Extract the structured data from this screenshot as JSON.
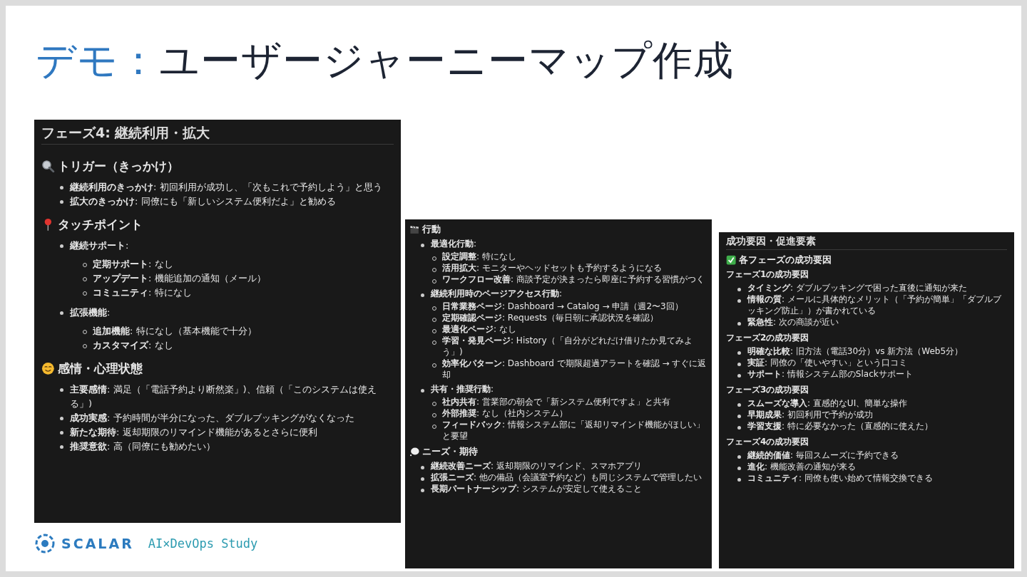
{
  "slide_title": {
    "accent": "デモ：",
    "main": "ユーザージャーニーマップ作成"
  },
  "panels": [
    {
      "blocks": [
        {
          "kind": "h2",
          "text": "フェーズ4: 継続利用・拡大"
        },
        {
          "kind": "h3",
          "text": "トリガー（きっかけ）"
        },
        {
          "kind": "list",
          "items": [
            {
              "text": "**継続利用のきっかけ**: 初回利用が成功し、「次もこれで予約しよう」と思う"
            },
            {
              "text": "**拡大のきっかけ**: 同僚にも「新しいシステム便利だよ」と勧める"
            }
          ]
        },
        {
          "kind": "h3",
          "text": "タッチポイント"
        },
        {
          "kind": "list",
          "items": [
            {
              "text": "**継続サポート**:",
              "children": [
                "**定期サポート**: なし",
                "**アップデート**: 機能追加の通知（メール）",
                "**コミュニティ**: 特になし"
              ]
            },
            {
              "text": "**拡張機能**:",
              "children": [
                "**追加機能**: 特になし（基本機能で十分）",
                "**カスタマイズ**: なし"
              ]
            }
          ]
        },
        {
          "kind": "h3",
          "text": "感情・心理状態"
        },
        {
          "kind": "list",
          "items": [
            {
              "text": "**主要感情**: 満足（「電話予約より断然楽」)、信頼（「このシステムは使える」)"
            },
            {
              "text": "**成功実感**: 予約時間が半分になった、ダブルブッキングがなくなった"
            },
            {
              "text": "**新たな期待**: 返却期限のリマインド機能があるとさらに便利"
            },
            {
              "text": "**推奨意欲**: 高（同僚にも勧めたい）"
            }
          ]
        }
      ]
    },
    {
      "blocks": [
        {
          "kind": "h3",
          "text": "行動"
        },
        {
          "kind": "list",
          "items": [
            {
              "text": "**最適化行動**:",
              "children": [
                "**設定調整**: 特になし",
                "**活用拡大**: モニターやヘッドセットも予約するようになる",
                "**ワークフロー改善**: 商談予定が決まったら即座に予約する習慣がつく"
              ]
            },
            {
              "text": "**継続利用時のページアクセス行動**:",
              "children": [
                "**日常業務ページ**: Dashboard → Catalog → 申請（週2〜3回）",
                "**定期確認ページ**: Requests（毎日朝に承認状況を確認）",
                "**最適化ページ**: なし",
                "**学習・発見ページ**: History（「自分がどれだけ借りたか見てみよう」)",
                "**効率化パターン**: Dashboard で期限超過アラートを確認 → すぐに返却"
              ]
            },
            {
              "text": "**共有・推奨行動**:",
              "children": [
                "**社内共有**: 営業部の朝会で「新システム便利ですよ」と共有",
                "**外部推奨**: なし（社内システム）",
                "**フィードバック**: 情報システム部に「返却リマインド機能がほしい」と要望"
              ]
            }
          ]
        },
        {
          "kind": "h3",
          "text": "ニーズ・期待"
        },
        {
          "kind": "list",
          "items": [
            {
              "text": "**継続改善ニーズ**: 返却期限のリマインド、スマホアプリ"
            },
            {
              "text": "**拡張ニーズ**: 他の備品（会議室予約など）も同じシステムで管理したい"
            },
            {
              "text": "**長期パートナーシップ**: システムが安定して使えること"
            }
          ]
        }
      ]
    },
    {
      "blocks": [
        {
          "kind": "h2",
          "text": "成功要因・促進要素"
        },
        {
          "kind": "h3",
          "text": "各フェーズの成功要因"
        },
        {
          "kind": "h4",
          "text": "フェーズ1の成功要因"
        },
        {
          "kind": "list",
          "items": [
            {
              "text": "**タイミング**: ダブルブッキングで困った直後に通知が来た"
            },
            {
              "text": "**情報の質**: メールに具体的なメリット（「予約が簡単」「ダブルブッキング防止」）が書かれている"
            },
            {
              "text": "**緊急性**: 次の商談が近い"
            }
          ]
        },
        {
          "kind": "h4",
          "text": "フェーズ2の成功要因"
        },
        {
          "kind": "list",
          "items": [
            {
              "text": "**明確な比較**: 旧方法（電話30分）vs 新方法（Web5分）"
            },
            {
              "text": "**実証**: 同僚の「使いやすい」という口コミ"
            },
            {
              "text": "**サポート**: 情報システム部のSlackサポート"
            }
          ]
        },
        {
          "kind": "h4",
          "text": "フェーズ3の成功要因"
        },
        {
          "kind": "list",
          "items": [
            {
              "text": "**スムーズな導入**: 直感的なUI、簡単な操作"
            },
            {
              "text": "**早期成果**: 初回利用で予約が成功"
            },
            {
              "text": "**学習支援**: 特に必要なかった（直感的に使えた）"
            }
          ]
        },
        {
          "kind": "h4",
          "text": "フェーズ4の成功要因"
        },
        {
          "kind": "list",
          "items": [
            {
              "text": "**継続的価値**: 毎回スムーズに予約できる"
            },
            {
              "text": "**進化**: 機能改善の通知が来る"
            },
            {
              "text": "**コミュニティ**: 同僚も使い始めて情報交換できる"
            }
          ]
        }
      ]
    }
  ],
  "footer": {
    "logo_text": "SCALAR",
    "tagline": "AI×DevOps Study"
  }
}
